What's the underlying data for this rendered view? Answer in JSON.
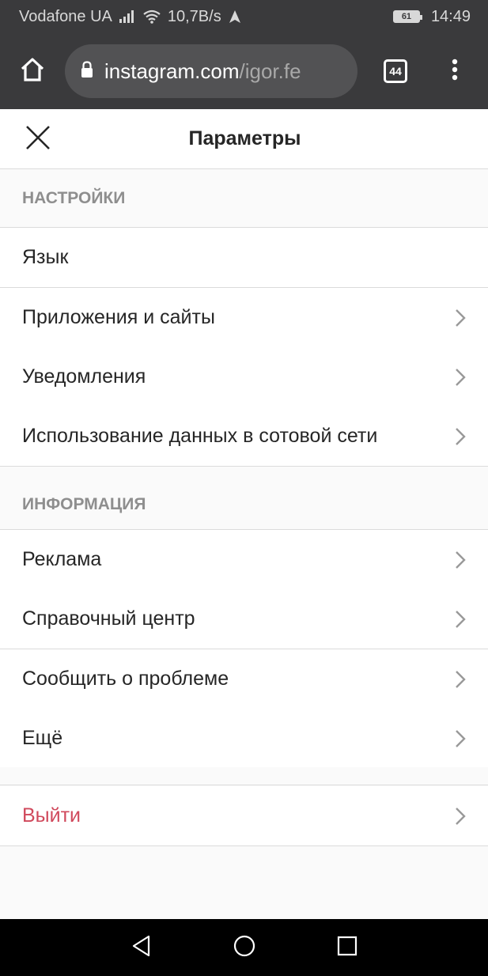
{
  "status_bar": {
    "carrier": "Vodafone UA",
    "speed": "10,7B/s",
    "battery": "61",
    "time": "14:49",
    "icons": [
      "signal-icon",
      "wifi-icon",
      "navigation-icon",
      "battery-icon"
    ]
  },
  "browser": {
    "url_domain": "instagram.com",
    "url_path": "/igor.fe",
    "tab_count": "44",
    "icons": [
      "home-icon",
      "lock-icon",
      "tabs-icon",
      "more-vert-icon"
    ]
  },
  "header": {
    "title": "Параметры",
    "close_icon": "close-icon"
  },
  "sections": {
    "settings": {
      "title": "НАСТРОЙКИ",
      "items": [
        {
          "label": "Язык",
          "has_chevron": false
        },
        {
          "label": "Приложения и сайты",
          "has_chevron": true
        },
        {
          "label": "Уведомления",
          "has_chevron": true
        },
        {
          "label": "Использование данных в сотовой сети",
          "has_chevron": true
        }
      ]
    },
    "info": {
      "title": "ИНФОРМАЦИЯ",
      "items": [
        {
          "label": "Реклама",
          "has_chevron": true
        },
        {
          "label": "Справочный центр",
          "has_chevron": true
        },
        {
          "label": "Сообщить о проблеме",
          "has_chevron": true
        },
        {
          "label": "Ещё",
          "has_chevron": true
        }
      ]
    }
  },
  "logout": {
    "label": "Выйти",
    "color": "#d0495c"
  },
  "nav_bar": {
    "icons": [
      "back-icon",
      "home-circle-icon",
      "recents-icon"
    ]
  },
  "colors": {
    "chrome_dark": "#3a3a3c",
    "separator": "#dbdbdb",
    "section_text": "#8e8e8e",
    "text": "#262626"
  }
}
